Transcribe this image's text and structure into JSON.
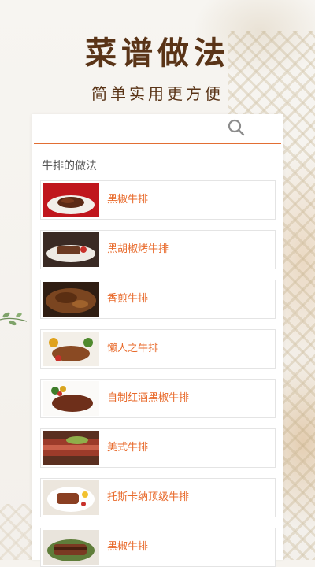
{
  "header": {
    "title": "菜谱做法",
    "subtitle": "简单实用更方便"
  },
  "search": {
    "icon": "search-icon"
  },
  "section": {
    "title": "牛排的做法"
  },
  "colors": {
    "accent": "#e26e33",
    "item_text": "#e86a2b",
    "title_brown": "#5a3417"
  },
  "recipes": [
    {
      "label": "黑椒牛排"
    },
    {
      "label": "黑胡椒烤牛排"
    },
    {
      "label": "香煎牛排"
    },
    {
      "label": "懒人之牛排"
    },
    {
      "label": "自制红酒黑椒牛排"
    },
    {
      "label": "美式牛排"
    },
    {
      "label": "托斯卡纳顶级牛排"
    },
    {
      "label": "黑椒牛排"
    }
  ]
}
